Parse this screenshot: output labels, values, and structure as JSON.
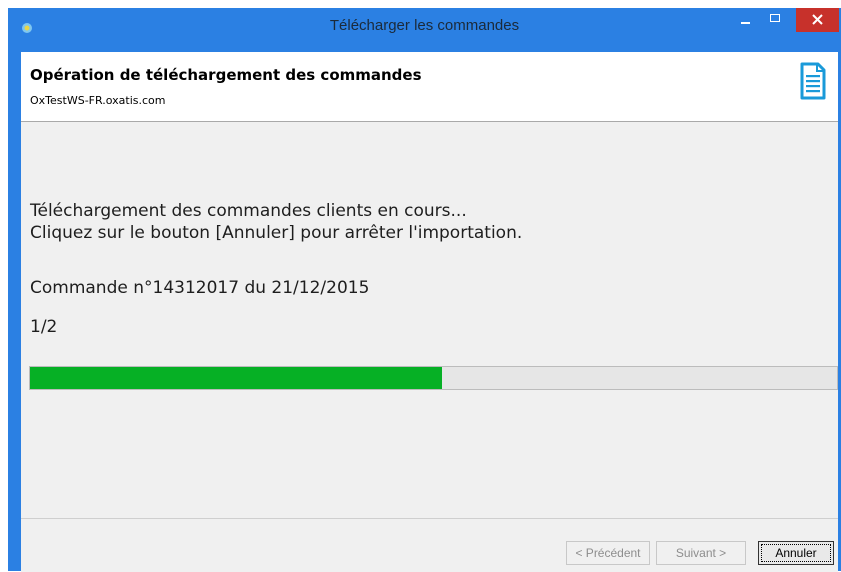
{
  "window": {
    "title": "Télécharger les commandes",
    "colors": {
      "frame": "#2b80e3",
      "close_button": "#c7312b",
      "progress": "#06b025"
    }
  },
  "header": {
    "title": "Opération de téléchargement des commandes",
    "subtitle": "OxTestWS-FR.oxatis.com",
    "icon": "document-icon"
  },
  "content": {
    "status_line1": "Téléchargement des commandes clients en cours...",
    "status_line2": "Cliquez sur le bouton [Annuler] pour arrêter l'importation.",
    "order_line": "Commande n°14312017 du 21/12/2015",
    "counter": "1/2",
    "progress_fraction": 0.51
  },
  "footer": {
    "prev_label": "< Précédent",
    "next_label": "Suivant >",
    "cancel_label": "Annuler"
  }
}
